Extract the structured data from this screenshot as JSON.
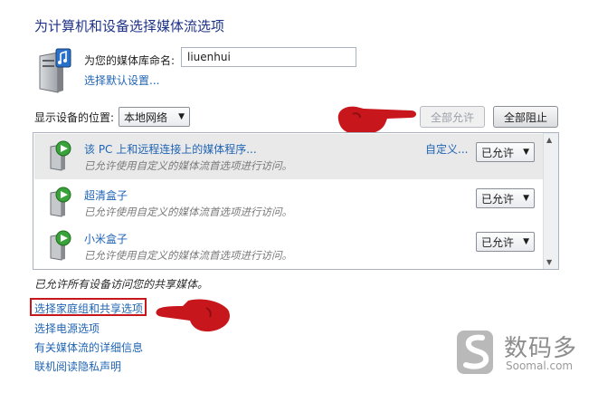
{
  "title": "为计算机和设备选择媒体流选项",
  "library": {
    "name_label": "为您的媒体库命名:",
    "name_value": "liuenhui",
    "default_settings_link": "选择默认设置..."
  },
  "device_filter": {
    "label": "显示设备的位置:",
    "selected": "本地网络"
  },
  "buttons": {
    "allow_all": "全部允许",
    "block_all": "全部阻止"
  },
  "devices": [
    {
      "name": "该 PC 上和远程连接上的媒体程序...",
      "description": "已允许使用自定义的媒体流首选项进行访问。",
      "custom_link": "自定义...",
      "permission": "已允许"
    },
    {
      "name": "超清盒子",
      "description": "已允许使用自定义的媒体流首选项进行访问。",
      "permission": "已允许"
    },
    {
      "name": "小米盒子",
      "description": "已允许使用自定义的媒体流首选项进行访问。",
      "permission": "已允许"
    }
  ],
  "status_text": "已允许所有设备访问您的共享媒体。",
  "links": {
    "homegroup": "选择家庭组和共享选项",
    "power": "选择电源选项",
    "details": "有关媒体流的详细信息",
    "privacy": "联机阅读隐私声明"
  },
  "watermark": {
    "name": "数码多",
    "url": "Soomal.com"
  },
  "colors": {
    "link": "#1f64b4",
    "title": "#1e3287",
    "annotation_red": "#c8161d",
    "selected_row": "#e9e9e9"
  },
  "icons": {
    "library": "media-library-icon",
    "device": "media-device-icon",
    "arrow": "pointing-hand-arrow"
  }
}
